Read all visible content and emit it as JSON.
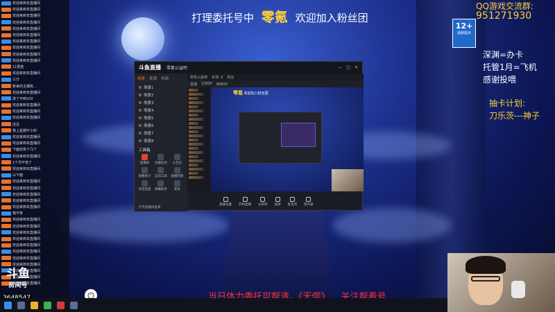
{
  "banner": {
    "prefix": "打理委托号中",
    "streamer": "零氪",
    "suffix": "欢迎加入粉丝团"
  },
  "qq": {
    "label": "QQ游戏交流群:",
    "number": "951271930"
  },
  "age_rating": {
    "badge": "12+",
    "caption": "适龄提示"
  },
  "right_notes": [
    "深渊=办卡",
    "托管1月=飞机",
    "感谢投喂"
  ],
  "draw_plan": {
    "label": "抽卡计划:",
    "entry": "刀乐茨---神子"
  },
  "caption": {
    "left": "当日体力委托可帮清，《无偿》",
    "right": "关注帮看号"
  },
  "douyu": {
    "logo": "斗鱼",
    "sub": "房间号",
    "room_id": "3648547"
  },
  "chat": {
    "messages": [
      "欢迎来到本直播间",
      "欢迎来到本直播间",
      "欢迎来到本直播间",
      "欢迎来到本直播间",
      "欢迎来到本直播间",
      "欢迎来到本直播间",
      "欢迎来到本直播间",
      "欢迎来到本直播间",
      "欢迎来到本直播间",
      "欢迎来到本直播间",
      "11把金",
      "欢迎来到本直播间",
      "三分",
      "新来的主播有...",
      "欢迎来到本直播间",
      "改了不到100",
      "欢迎来到本直播间",
      "欢迎来到本直播间",
      "欢迎来到本直播间",
      "还没",
      "我上星期不小的",
      "欢迎来到本直播间",
      "欢迎来到本直播间",
      "下面还有十几个",
      "欢迎来到本直播间",
      "1个月不管了",
      "欢迎来到本直播间",
      "山下面",
      "欢迎来到本直播间",
      "欢迎来到本直播间",
      "欢迎来到本直播间",
      "欢迎来到本直播间",
      "欢迎来到本直播间",
      "我不管",
      "欢迎来到本直播间",
      "欢迎来到本直播间",
      "欢迎来到本直播间",
      "欢迎来到本直播间",
      "欢迎来到本直播间",
      "欢迎来到本直播间",
      "欢迎来到本直播间",
      "欢迎来到本直播间",
      "欢迎来到本直播间",
      "欢迎来到本直播间",
      "欢迎来到本直播间"
    ]
  },
  "app": {
    "logo": "斗鱼直播",
    "title_tab": "零氪公益吧",
    "side_tabs": [
      "场景",
      "来源",
      "布局"
    ],
    "scenes": [
      "场景1",
      "场景2",
      "场景3",
      "场景4",
      "场景5",
      "场景6",
      "场景7",
      "场景8"
    ],
    "tools_label": "工具箱",
    "tools": [
      "直播间",
      "主播任务",
      "公告栏",
      "观看统计",
      "互动工具",
      "直播回放",
      "语音连麦",
      "弹幕助手",
      "更多"
    ],
    "footer": "打开直播间查看",
    "bar1": [
      "零氪公益吧",
      "本场: 0",
      "粉丝"
    ],
    "bar2": [
      "直播",
      "1080P",
      "帧率60"
    ],
    "preview_text_name": "零氪",
    "preview_text_other": "欢迎加入粉丝团",
    "controls": [
      "直播设置",
      "开始直播",
      "分辨率",
      "美颜",
      "麦克风",
      "扬声器"
    ]
  },
  "colors": {
    "accent": "#ffd23a",
    "caption_red": "#ff3030",
    "chat_badge": "#e8732a"
  }
}
